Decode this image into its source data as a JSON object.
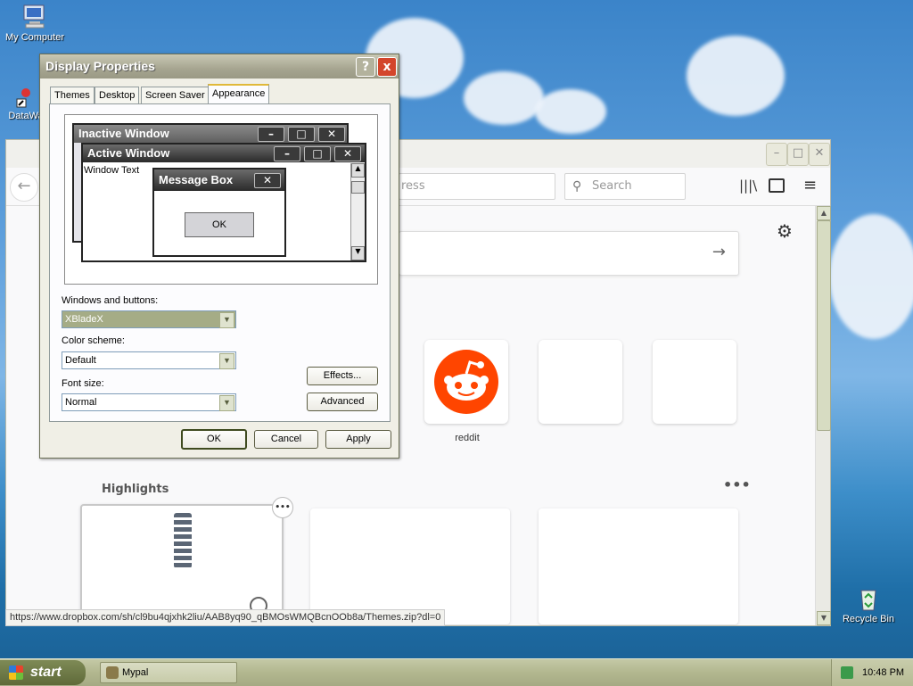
{
  "desktop": {
    "icons": [
      {
        "label": "My Computer"
      },
      {
        "label": "DataWa"
      },
      {
        "label": "Recycle Bin"
      }
    ]
  },
  "browser": {
    "search_placeholder": "Search",
    "url_placeholder": "ress",
    "top_sites": [
      {
        "label": ""
      },
      {
        "label": "reddit"
      },
      {
        "label": ""
      },
      {
        "label": ""
      }
    ],
    "highlights_title": "Highlights",
    "status_url": "https://www.dropbox.com/sh/cl9bu4qjxhk2liu/AAB8yq90_qBMOsWMQBcnOOb8a/Themes.zip?dl=0"
  },
  "dialog": {
    "title": "Display Properties",
    "help_icon": "?",
    "close_icon": "x",
    "tabs": [
      {
        "label": "Themes"
      },
      {
        "label": "Desktop"
      },
      {
        "label": "Screen Saver"
      },
      {
        "label": "Appearance",
        "active": true
      }
    ],
    "preview": {
      "inactive_title": "Inactive Window",
      "active_title": "Active Window",
      "window_text": "Window Text",
      "message_title": "Message Box",
      "ok": "OK"
    },
    "windows_buttons_label": "Windows and buttons:",
    "windows_buttons_value": "XBladeX",
    "color_scheme_label": "Color scheme:",
    "color_scheme_value": "Default",
    "font_size_label": "Font size:",
    "font_size_value": "Normal",
    "effects_button": "Effects...",
    "advanced_button": "Advanced",
    "ok_button": "OK",
    "cancel_button": "Cancel",
    "apply_button": "Apply"
  },
  "taskbar": {
    "start_label": "start",
    "task_label": "Mypal",
    "clock": "10:48 PM"
  },
  "colors": {
    "reddit": "#ff4500",
    "xp_olive": "#a6a590"
  }
}
